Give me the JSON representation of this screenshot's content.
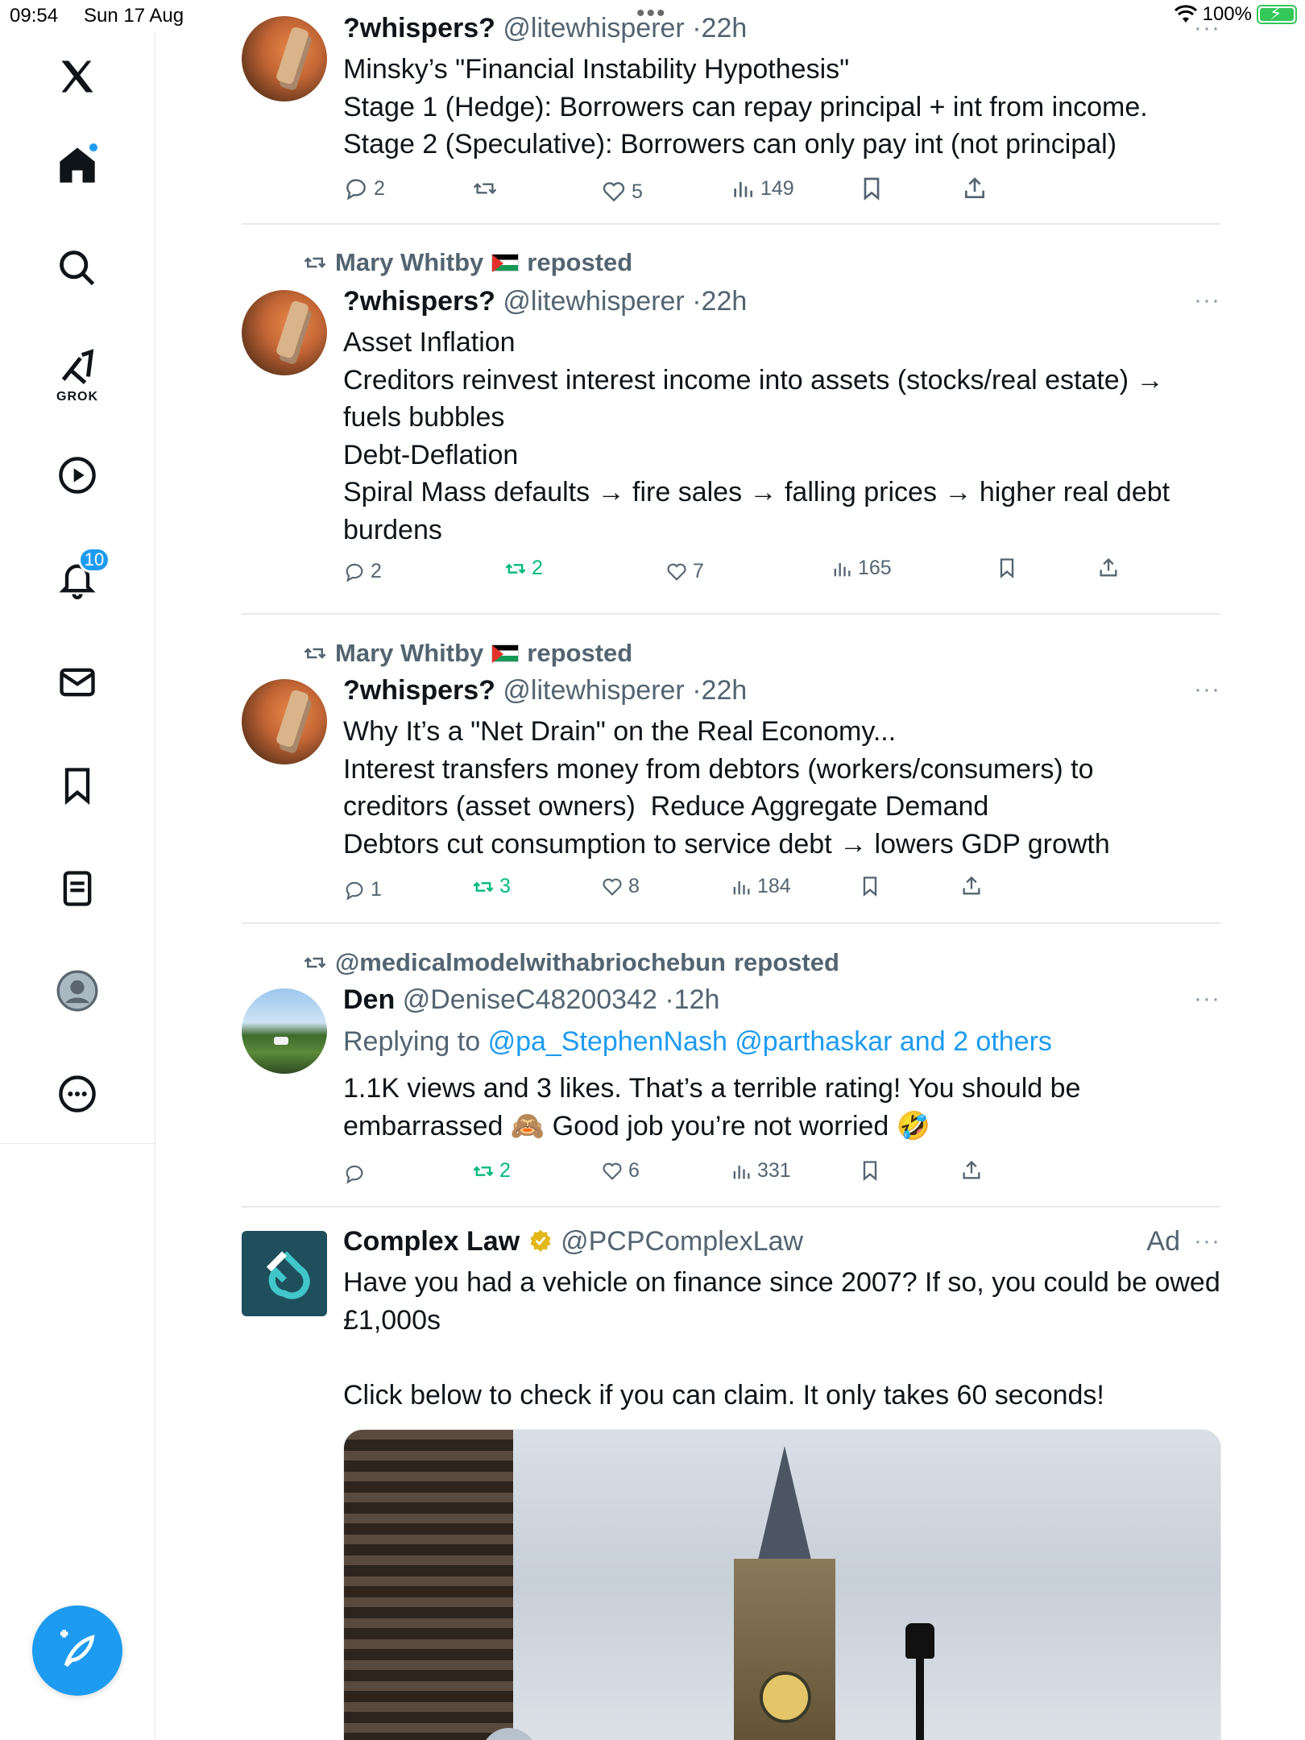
{
  "status_bar": {
    "time": "09:54",
    "date": "Sun 17 Aug",
    "battery": "100%"
  },
  "sidebar": {
    "items": [
      {
        "name": "x-logo",
        "label": "X"
      },
      {
        "name": "home",
        "label": "Home"
      },
      {
        "name": "search",
        "label": "Search"
      },
      {
        "name": "grok",
        "label": "GROK"
      },
      {
        "name": "video",
        "label": "Video"
      },
      {
        "name": "notifications",
        "label": "Notifications",
        "badge": "10"
      },
      {
        "name": "messages",
        "label": "Messages"
      },
      {
        "name": "bookmarks",
        "label": "Bookmarks"
      },
      {
        "name": "lists",
        "label": "Lists"
      },
      {
        "name": "profile",
        "label": "Profile"
      },
      {
        "name": "more",
        "label": "More"
      }
    ],
    "compose_label": "+"
  },
  "colors": {
    "accent": "#1d9bf0",
    "secondary_text": "#536471",
    "repost_green": "#00ba7c",
    "divider": "#e6e9eb"
  },
  "tweets": [
    {
      "name": "?whispers?",
      "handle": "@litewhisperer",
      "time": "22h",
      "lines": [
        "Minsky’s \"Financial Instability Hypothesis\"",
        "Stage 1 (Hedge): Borrowers can repay principal + int from income.",
        "Stage 2 (Speculative): Borrowers can only pay int (not principal)"
      ],
      "replies": "2",
      "reposts": "",
      "likes": "5",
      "views": "149"
    },
    {
      "repost_by": "Mary Whitby",
      "repost_suffix": "reposted",
      "name": "?whispers?",
      "handle": "@litewhisperer",
      "time": "22h",
      "lines": [
        "Asset Inflation",
        "Creditors reinvest interest income into assets (stocks/real estate) →",
        "fuels bubbles",
        "Debt-Deflation",
        "Spiral Mass defaults → fire sales → falling prices → higher real debt",
        "burdens"
      ],
      "replies": "2",
      "reposts": "2",
      "likes": "7",
      "views": "165"
    },
    {
      "repost_by": "Mary Whitby",
      "repost_suffix": "reposted",
      "name": "?whispers?",
      "handle": "@litewhisperer",
      "time": "22h",
      "lines": [
        "Why It’s a \"Net Drain\" on the Real Economy...",
        "Interest transfers money from debtors (workers/consumers) to",
        "creditors (asset owners)  Reduce Aggregate Demand",
        "Debtors cut consumption to service debt → lowers GDP growth"
      ],
      "replies": "1",
      "reposts": "3",
      "likes": "8",
      "views": "184"
    },
    {
      "repost_by": "@medicalmodelwithabriochebun",
      "repost_suffix": "reposted",
      "name": "Den",
      "handle": "@DeniseC48200342",
      "time": "12h",
      "replying_prefix": "Replying to",
      "replying_to": "@pa_StephenNash @parthaskar and 2 others",
      "lines": [
        "1.1K views and 3 likes. That’s a terrible rating! You should be",
        "embarrassed 🙈 Good job you’re not worried 🤣"
      ],
      "replies": "",
      "reposts": "2",
      "likes": "6",
      "views": "331"
    },
    {
      "name": "Complex Law",
      "handle": "@PCPComplexLaw",
      "ad_label": "Ad",
      "lines": [
        "Have you had a vehicle on finance since 2007? If so, you could be owed",
        "£1,000s",
        "",
        "Click below to check if you can claim. It only takes 60 seconds!"
      ]
    }
  ]
}
